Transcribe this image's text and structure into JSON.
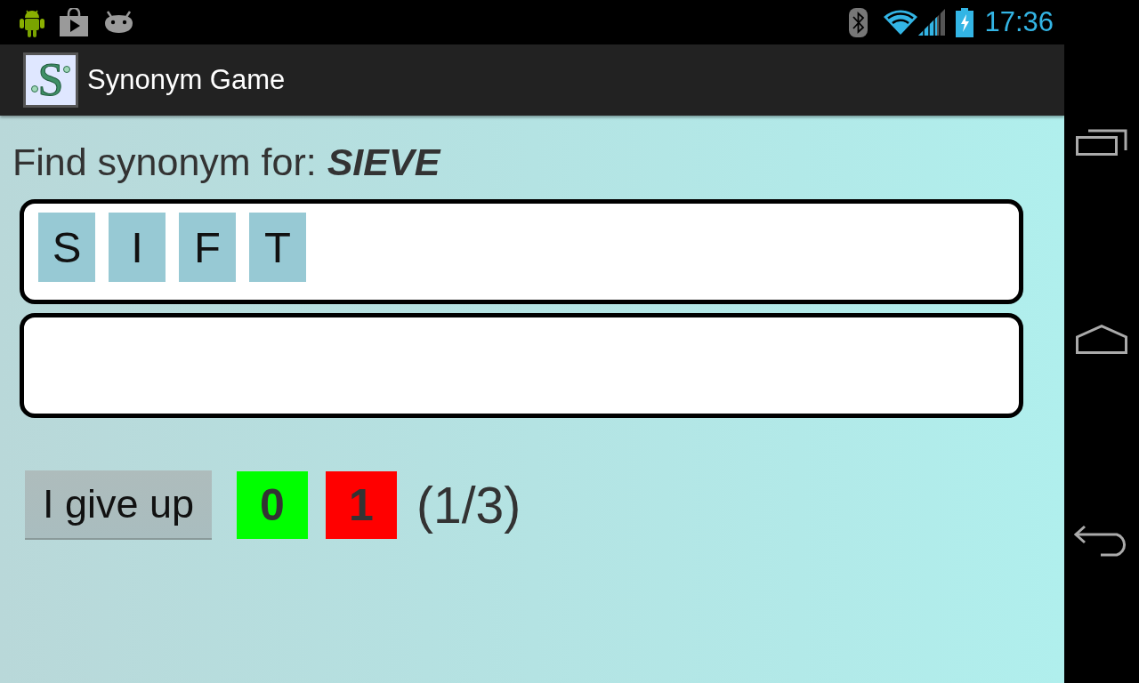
{
  "status_bar": {
    "time": "17:36"
  },
  "action_bar": {
    "logo_letter": "S",
    "title": "Synonym Game"
  },
  "prompt": "Find synonym for: **SIEVE**",
  "answer_box": {
    "tiles": [
      "S",
      "I",
      "F",
      "T"
    ]
  },
  "give_up_button": {
    "label": "I give up"
  },
  "score": [
    {
      "value": "0",
      "color": "#00ff00"
    },
    {
      "value": "1",
      "color": "#ff0000"
    }
  ],
  "progress": "(1/3)"
}
